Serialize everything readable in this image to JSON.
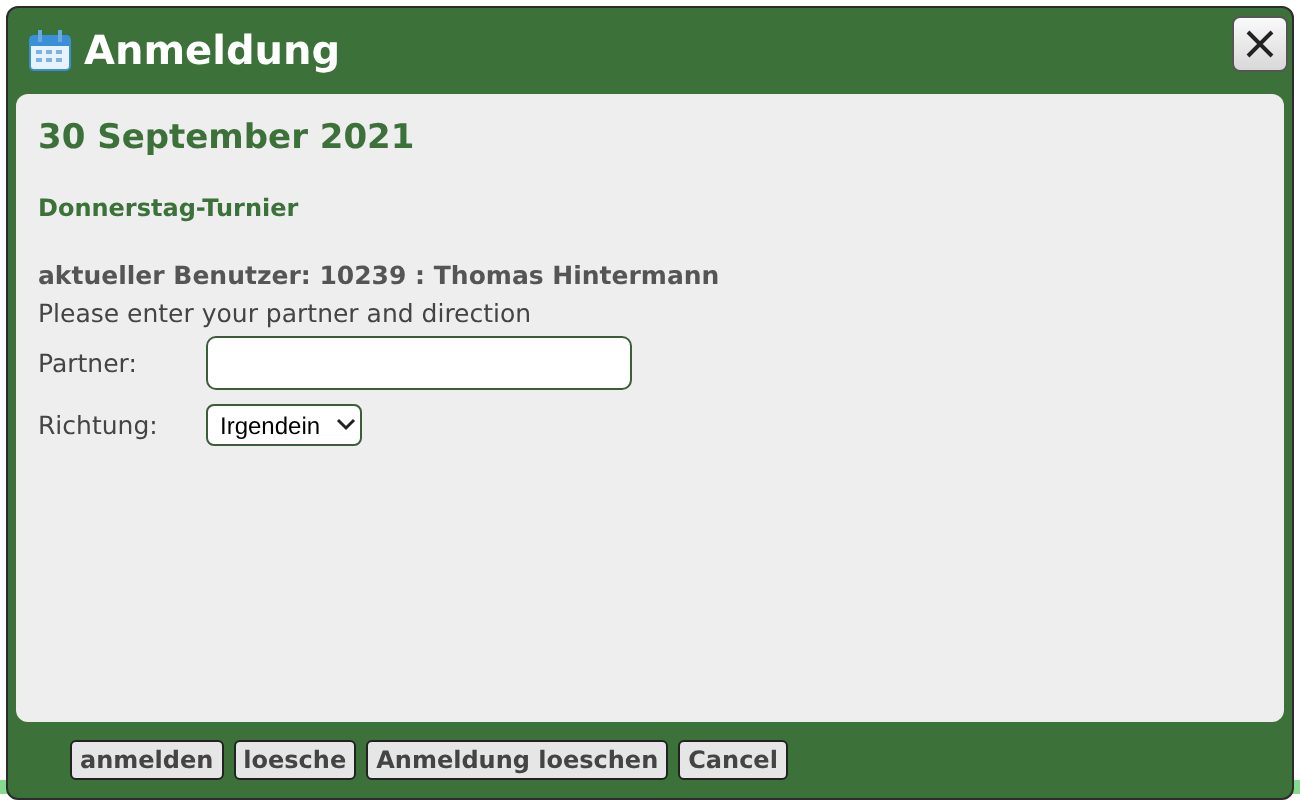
{
  "window": {
    "title": "Anmeldung"
  },
  "date": "30 September 2021",
  "event": "Donnerstag-Turnier",
  "user": "aktueller Benutzer: 10239 : Thomas Hintermann",
  "instruction": "Please enter your partner and direction",
  "fields": [
    {
      "kind": "text",
      "label": "Partner:"
    },
    {
      "kind": "select",
      "label": "Richtung:",
      "value": "Irgendein"
    }
  ],
  "buttons": [
    "anmelden",
    "loesche",
    "Anmeldung loeschen",
    "Cancel"
  ]
}
